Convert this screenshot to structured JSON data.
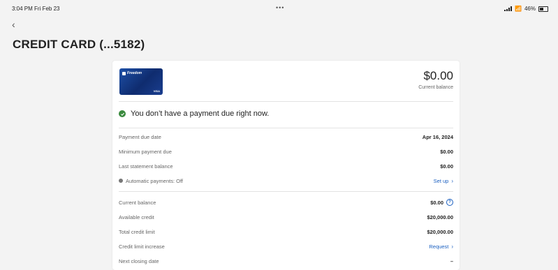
{
  "status_bar": {
    "time_date": "3:04 PM  Fri Feb 23",
    "multitask_dots": "•••",
    "battery": "46%"
  },
  "header": {
    "title": "CREDIT CARD (...5182)"
  },
  "card": {
    "brand": "Freedom",
    "network": "VISA"
  },
  "balance": {
    "amount": "$0.00",
    "label": "Current balance"
  },
  "due_banner": {
    "text": "You don’t have a payment due right now."
  },
  "payment_rows": [
    {
      "label": "Payment due date",
      "value": "Apr 16, 2024"
    },
    {
      "label": "Minimum payment due",
      "value": "$0.00"
    },
    {
      "label": "Last statement balance",
      "value": "$0.00"
    },
    {
      "label": "Automatic payments: Off",
      "value": "Set up"
    }
  ],
  "credit_rows": [
    {
      "label": "Current balance",
      "value": "$0.00"
    },
    {
      "label": "Available credit",
      "value": "$20,000.00"
    },
    {
      "label": "Total credit limit",
      "value": "$20,000.00"
    },
    {
      "label": "Credit limit increase",
      "value": "Request"
    },
    {
      "label": "Next closing date",
      "value": "–"
    }
  ],
  "colors": {
    "accent": "#1a5fc0",
    "success": "#3a8a3e"
  }
}
